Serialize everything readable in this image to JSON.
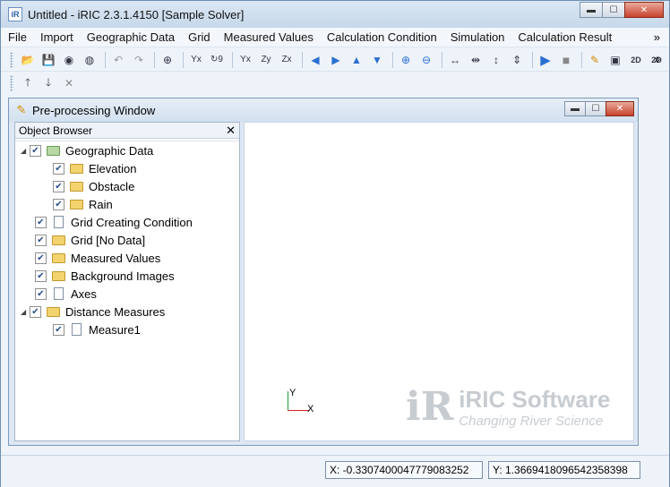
{
  "window": {
    "title": "Untitled - iRIC 2.3.1.4150 [Sample Solver]",
    "app_icon_text": "iR",
    "minimize": "▬",
    "maximize": "☐",
    "close": "✕"
  },
  "menubar": {
    "items": [
      "File",
      "Import",
      "Geographic Data",
      "Grid",
      "Measured Values",
      "Calculation Condition",
      "Simulation",
      "Calculation Result"
    ],
    "overflow": "»"
  },
  "toolbar": {
    "overflow": "»",
    "icons": [
      "open-folder",
      "save",
      "snapshot",
      "globe",
      "undo",
      "redo",
      "zoom-fit",
      "y-x-axis",
      "rotate-90",
      "x-sub",
      "z-sub-y",
      "z-sub-x",
      "arrow-left",
      "arrow-right",
      "arrow-up",
      "arrow-down",
      "zoom-in",
      "zoom-out",
      "move-h",
      "move-h2",
      "move-v",
      "move-v2",
      "run",
      "stop",
      "pencil",
      "console",
      "2d-view",
      "2d-view-alt"
    ]
  },
  "toolbar2": {
    "icons": [
      "arrow-up-small",
      "arrow-down-small",
      "delete-x"
    ]
  },
  "child_window": {
    "title": "Pre-processing Window"
  },
  "object_browser": {
    "title": "Object Browser",
    "close": "✕",
    "items": [
      {
        "label": "Geographic Data",
        "checked": true
      },
      {
        "label": "Elevation",
        "checked": true
      },
      {
        "label": "Obstacle",
        "checked": true
      },
      {
        "label": "Rain",
        "checked": true
      },
      {
        "label": "Grid Creating Condition",
        "checked": true
      },
      {
        "label": "Grid [No Data]",
        "checked": true
      },
      {
        "label": "Measured Values",
        "checked": true
      },
      {
        "label": "Background Images",
        "checked": true
      },
      {
        "label": "Axes",
        "checked": true
      },
      {
        "label": "Distance Measures",
        "checked": true
      },
      {
        "label": "Measure1",
        "checked": true
      }
    ]
  },
  "canvas": {
    "axis_y": "Y",
    "axis_x": "X",
    "watermark_line1": "iRIC Software",
    "watermark_line2": "Changing River Science",
    "watermark_logo": "iR"
  },
  "status": {
    "x": "X: -0.3307400047779083252",
    "y": "Y: 1.3669418096542358398"
  }
}
